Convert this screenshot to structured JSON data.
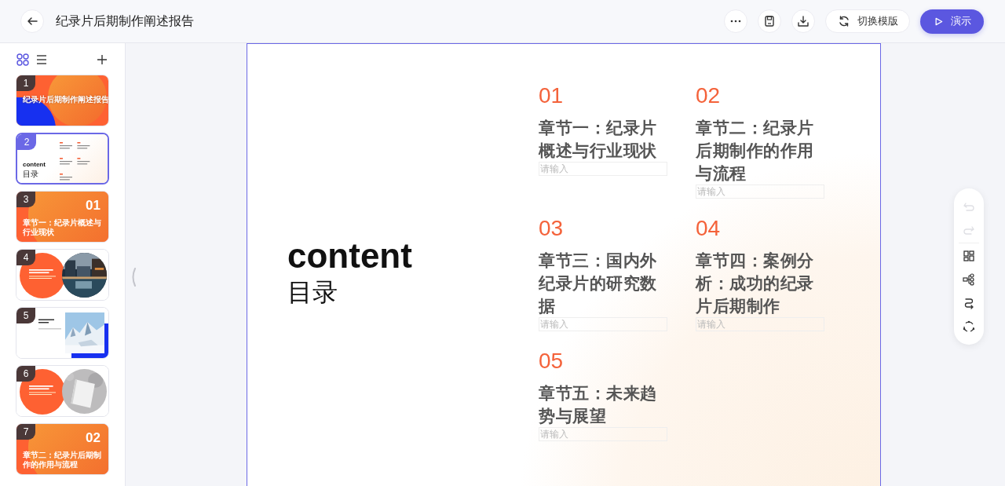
{
  "window": {
    "title": "纪录片后期制作阐述报告"
  },
  "toolbar": {
    "buttons": [
      {
        "kind": "more"
      },
      {
        "kind": "save"
      },
      {
        "kind": "download"
      },
      {
        "kind": "switch",
        "label": "切换模版"
      },
      {
        "kind": "present",
        "label": "演示"
      }
    ]
  },
  "sidebar": {
    "view_modes": [
      {
        "kind": "grid",
        "selected": true
      },
      {
        "kind": "list",
        "selected": false
      }
    ],
    "slides": [
      {
        "number": "1",
        "kind": "cover",
        "selected": false,
        "title": "纪录片后期制作阐述报告"
      },
      {
        "number": "2",
        "kind": "contents",
        "selected": true,
        "heading": "content",
        "subheading": "目录"
      },
      {
        "number": "3",
        "kind": "section",
        "selected": false,
        "big_number": "01",
        "title": "章节一：纪录片概述与行业现状"
      },
      {
        "number": "4",
        "kind": "circle-photo",
        "selected": false
      },
      {
        "number": "5",
        "kind": "rect-photo",
        "selected": false
      },
      {
        "number": "6",
        "kind": "circle-photo",
        "selected": false
      },
      {
        "number": "7",
        "kind": "section",
        "selected": false,
        "big_number": "02",
        "title": "章节二：纪录片后期制作的作用与流程"
      }
    ]
  },
  "slide": {
    "heading": "content",
    "subheading": "目录",
    "chapters": [
      {
        "number": "01",
        "title": "章节一：纪录片概述与行业现状",
        "placeholder": "请输入"
      },
      {
        "number": "02",
        "title": "章节二：纪录片后期制作的作用与流程",
        "placeholder": "请输入"
      },
      {
        "number": "03",
        "title": "章节三：国内外纪录片的研究数据",
        "placeholder": "请输入"
      },
      {
        "number": "04",
        "title": "章节四：案例分析：成功的纪录片后期制作",
        "placeholder": "请输入"
      },
      {
        "number": "05",
        "title": "章节五：未来趋势与展望",
        "placeholder": "请输入"
      }
    ]
  },
  "side_tools": [
    {
      "kind": "undo",
      "disabled": true
    },
    {
      "kind": "redo",
      "disabled": true
    },
    {
      "kind": "layout",
      "disabled": false
    },
    {
      "kind": "hierarchy",
      "disabled": false
    },
    {
      "kind": "route",
      "disabled": false
    },
    {
      "kind": "cycle",
      "disabled": false
    }
  ]
}
